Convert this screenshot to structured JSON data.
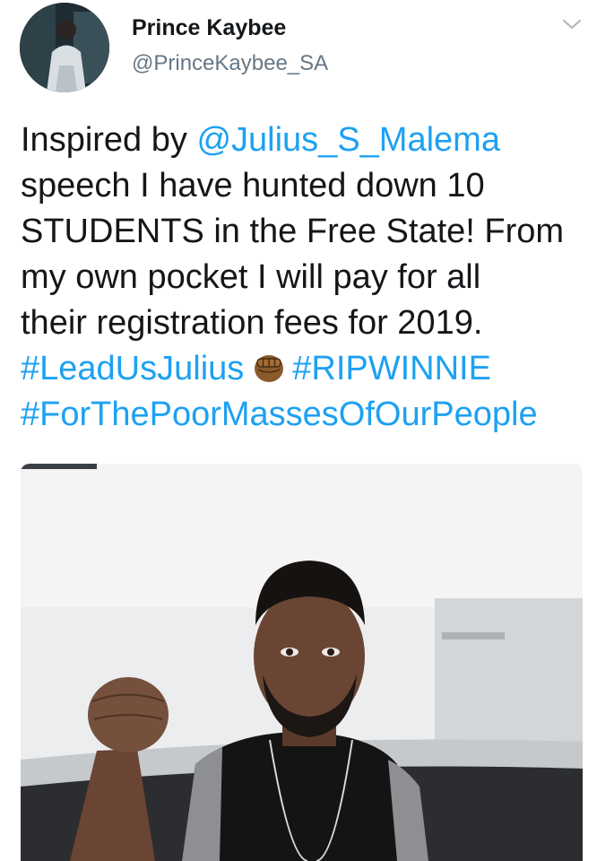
{
  "author": {
    "display_name": "Prince Kaybee",
    "handle": "@PrinceKaybee_SA"
  },
  "tweet": {
    "lines": [
      [
        {
          "text": "Inspired by ",
          "link": false
        },
        {
          "text": "@Julius_S_Malema",
          "link": true
        }
      ],
      [
        {
          "text": "speech I have hunted down 10",
          "link": false
        }
      ],
      [
        {
          "text": "STUDENTS in the Free State! From",
          "link": false
        }
      ],
      [
        {
          "text": "my own pocket I will pay for all",
          "link": false
        }
      ],
      [
        {
          "text": "their registration fees for 2019.",
          "link": false
        }
      ],
      [
        {
          "text": "#LeadUsJulius",
          "link": true
        },
        {
          "emoji": "raised-fist"
        },
        {
          "text": "#RIPWINNIE",
          "link": true
        }
      ],
      [
        {
          "text": "#ForThePoorMassesOfOurPeople",
          "link": true
        }
      ]
    ]
  },
  "icons": {
    "menu": "chevron-down-icon",
    "emoji": "raised-fist-emoji"
  },
  "colors": {
    "text": "#14171a",
    "secondary": "#657786",
    "link": "#1da1f2"
  },
  "media": {
    "type": "photo"
  }
}
